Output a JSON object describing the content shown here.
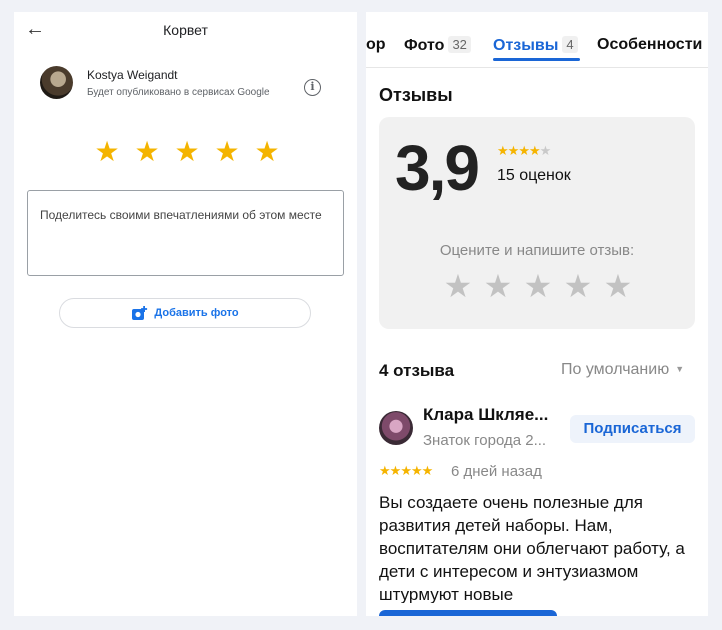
{
  "left_panel": {
    "header": {
      "back_icon": "arrow-left-icon",
      "title": "Корвет"
    },
    "user": {
      "name": "Kostya Weigandt",
      "subtitle": "Будет опубликовано в сервисах Google",
      "info_icon": "info-icon"
    },
    "rating": {
      "stars": 5,
      "icon": "star-icon"
    },
    "review_input": {
      "placeholder": "Поделитесь своими впечатлениями об этом месте"
    },
    "add_photo": {
      "icon": "add-photo-icon",
      "label": "Добавить фото"
    },
    "colors": {
      "star": "#f4b400",
      "accent": "#1a73e8"
    }
  },
  "right_panel": {
    "tabs": [
      {
        "label": "ор",
        "count": ""
      },
      {
        "label": "Фото",
        "count": "32"
      },
      {
        "label": "Отзывы",
        "count": "4",
        "active": true
      },
      {
        "label": "Особенности",
        "count": ""
      }
    ],
    "section_title": "Отзывы",
    "summary": {
      "rating": "3,9",
      "mini_stars_filled": 4,
      "reviews_count": "15 оценок",
      "rate_prompt": "Оцените и напишите отзыв:",
      "rate_stars": 5
    },
    "list": {
      "count_label": "4 отзыва",
      "sort_label": "По умолчанию",
      "sort_icon": "caret-down-icon"
    },
    "review": {
      "author": "Клара Шкляе...",
      "level": "Знаток города 2...",
      "subscribe_label": "Подписаться",
      "stars": 5,
      "date": "6 дней назад",
      "text": "Вы создаете очень полезные для развития детей наборы. Нам, воспитателям они облегчают работу, а дети с интересом и энтузиазмом штурмуют новые"
    },
    "colors": {
      "accent": "#1a66d6",
      "star": "#f5b400",
      "star_empty": "#c2c2c2"
    }
  }
}
